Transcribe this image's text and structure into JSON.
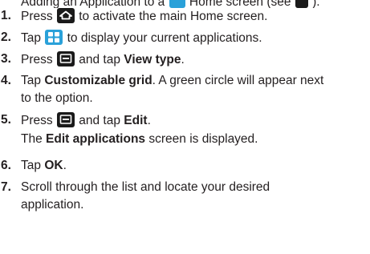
{
  "top_clipped": {
    "before": "Adding an Application to a",
    "middle": "Home screen (see",
    "end": ")."
  },
  "steps": [
    {
      "num": "1.",
      "a": "Press",
      "b": "to activate the main Home screen."
    },
    {
      "num": "2.",
      "a": "Tap",
      "b": "to display your current applications."
    },
    {
      "num": "3.",
      "a": "Press",
      "b": "and tap",
      "bold": "View type",
      "c": "."
    },
    {
      "num": "4.",
      "a": "Tap",
      "bold": "Customizable grid",
      "b": ". A green circle will appear next",
      "cont": "to the option."
    },
    {
      "num": "5.",
      "a": "Press",
      "b": "and tap",
      "bold": "Edit",
      "c": "."
    },
    {
      "note_a": "The",
      "note_bold": "Edit applications",
      "note_b": "screen is displayed."
    },
    {
      "num": "6.",
      "a": "Tap",
      "bold": "OK",
      "c": "."
    },
    {
      "num": "7.",
      "a": "Scroll through the list and locate your desired",
      "cont": "application."
    }
  ],
  "icons": {
    "home": "home-key-icon",
    "apps": "applications-icon",
    "menu": "menu-key-icon"
  },
  "colors": {
    "text": "#231f20",
    "apps_icon_bg": "#2aa1d9",
    "key_icon_bg": "#1a1a1a"
  }
}
